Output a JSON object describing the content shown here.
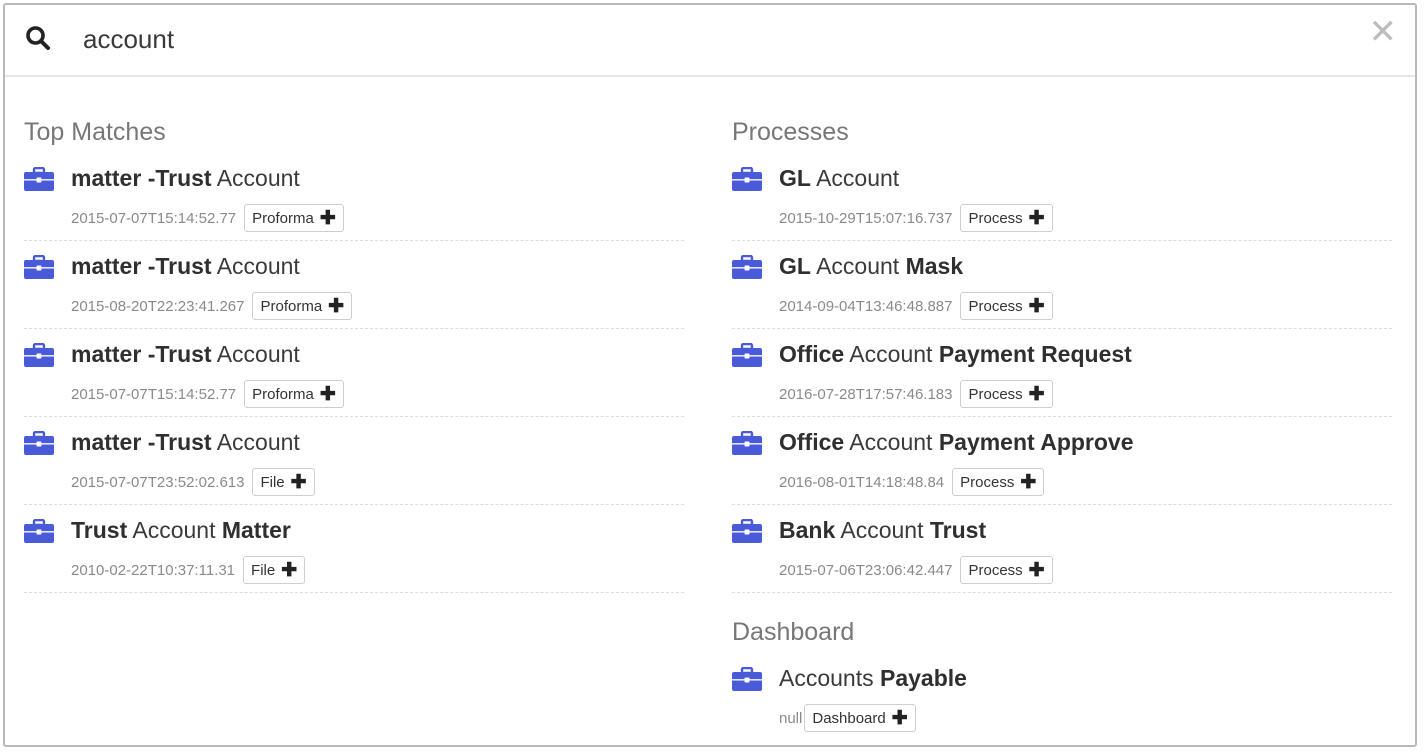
{
  "search": {
    "value": "account"
  },
  "top_matches": {
    "title": "Top Matches",
    "items": [
      {
        "t1": "matter -Trust",
        "t2": " Account",
        "ts": "2015-07-07T15:14:52.77",
        "tag": "Proforma"
      },
      {
        "t1": "matter -Trust",
        "t2": " Account",
        "ts": "2015-08-20T22:23:41.267",
        "tag": "Proforma"
      },
      {
        "t1": "matter -Trust",
        "t2": " Account",
        "ts": "2015-07-07T15:14:52.77",
        "tag": "Proforma"
      },
      {
        "t1": "matter -Trust",
        "t2": " Account",
        "ts": "2015-07-07T23:52:02.613",
        "tag": "File"
      },
      {
        "t1": "Trust",
        "t2": " Account ",
        "t3": "Matter",
        "ts": "2010-02-22T10:37:11.31",
        "tag": "File"
      }
    ]
  },
  "processes": {
    "title": "Processes",
    "items": [
      {
        "t1": "GL",
        "t2": " Account",
        "ts": "2015-10-29T15:07:16.737",
        "tag": "Process"
      },
      {
        "t1": "GL",
        "t2": " Account ",
        "t3": "Mask",
        "ts": "2014-09-04T13:46:48.887",
        "tag": "Process"
      },
      {
        "t1": "Office",
        "t2": " Account ",
        "t3": "Payment Request",
        "ts": "2016-07-28T17:57:46.183",
        "tag": "Process"
      },
      {
        "t1": "Office",
        "t2": " Account ",
        "t3": "Payment Approve",
        "ts": "2016-08-01T14:18:48.84",
        "tag": "Process"
      },
      {
        "t1": "Bank",
        "t2": " Account ",
        "t3": "Trust",
        "ts": "2015-07-06T23:06:42.447",
        "tag": "Process"
      }
    ]
  },
  "dashboard": {
    "title": "Dashboard",
    "items": [
      {
        "t2": "Account",
        "t4": "s ",
        "t3": "Payable",
        "ts": "null",
        "tag": "Dashboard"
      }
    ]
  },
  "colors": {
    "icon": "#4a5bd9"
  }
}
